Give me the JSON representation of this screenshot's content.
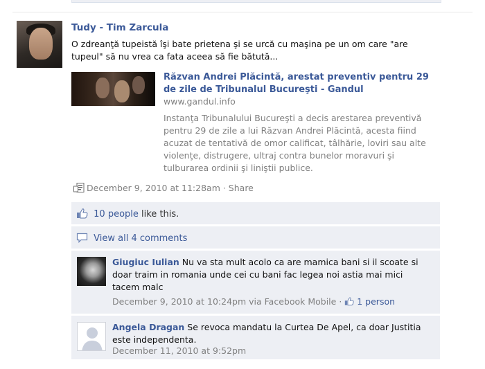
{
  "post": {
    "author": "Tudy - Tim Zarcula",
    "message": "O zdreanţă tupeistă îşi bate prietena şi se urcă cu maşina pe un om care \"are tupeul\" să nu vrea ca fata aceea să fie bătută...",
    "link": {
      "title": "Răzvan Andrei Plăcintă, arestat preventiv pentru 29 de zile de Tribunalul Bucureşti - Gandul",
      "domain": "www.gandul.info",
      "description": "Instanţa Tribunalului Bucureşti a decis arestarea preventivă pentru 29 de zile a lui Răzvan Andrei Plăcintă, acesta fiind acuzat de tentativă de omor calificat, tâlhărie, loviri sau alte violenţe, distrugere, ultraj contra bunelor moravuri şi tulburarea ordinii şi liniştii publice."
    },
    "timestamp": "December 9, 2010 at 11:28am",
    "separator": " · ",
    "share_label": "Share"
  },
  "likes": {
    "count_label": "10 people",
    "suffix": " like this."
  },
  "comments": {
    "view_all_label": "View all 4 comments",
    "items": [
      {
        "author": "Giugiuc Iulian",
        "text": " Nu va sta mult acolo ca are mamica bani si il scoate si doar traim in romania unde cei cu bani fac legea noi astia mai mici tacem malc",
        "timestamp": "December 9, 2010 at 10:24pm via Facebook Mobile",
        "separator": " · ",
        "like_count": "1 person"
      },
      {
        "author": "Angela Dragan",
        "text": " Se revoca mandatu la Curtea De Apel, ca doar Justitia este independenta.",
        "timestamp": "December 11, 2010 at 9:52pm"
      }
    ]
  },
  "icons": {
    "post_type": "link-post-icon",
    "like": "thumbs-up-icon",
    "comment": "comment-bubble-icon",
    "silhouette": "default-avatar-silhouette"
  },
  "colors": {
    "link": "#3b5998",
    "box_background": "#edeff4",
    "meta_text": "#808080"
  }
}
